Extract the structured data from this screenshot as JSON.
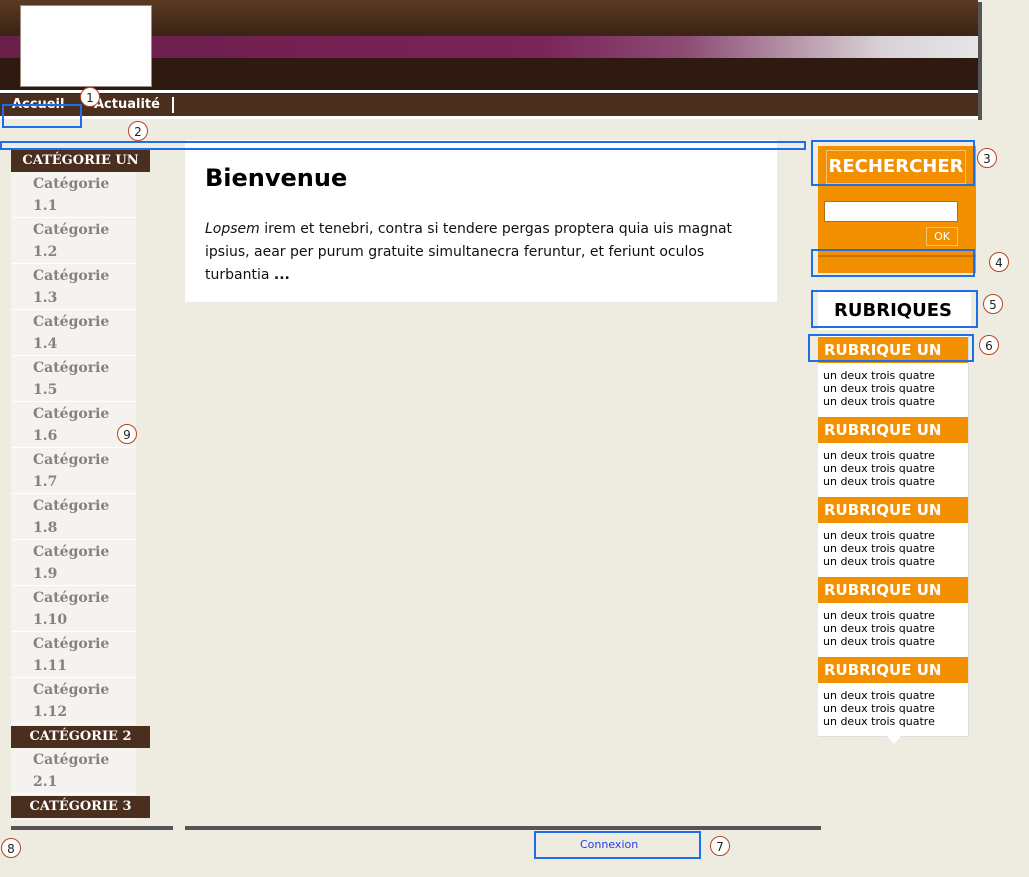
{
  "nav": {
    "items": [
      "Accueil",
      "Actualité"
    ]
  },
  "sidebar": {
    "categories": [
      {
        "label": "CATÉGORIE UN",
        "items": [
          [
            "Catégorie",
            "1.1"
          ],
          [
            "Catégorie",
            "1.2"
          ],
          [
            "Catégorie",
            "1.3"
          ],
          [
            "Catégorie",
            "1.4"
          ],
          [
            "Catégorie",
            "1.5"
          ],
          [
            "Catégorie",
            "1.6"
          ],
          [
            "Catégorie",
            "1.7"
          ],
          [
            "Catégorie",
            "1.8"
          ],
          [
            "Catégorie",
            "1.9"
          ],
          [
            "Catégorie",
            "1.10"
          ],
          [
            "Catégorie",
            "1.11"
          ],
          [
            "Catégorie",
            "1.12"
          ]
        ]
      },
      {
        "label": "CATÉGORIE 2",
        "items": [
          [
            "Catégorie",
            "2.1"
          ]
        ]
      },
      {
        "label": "CATÉGORIE 3",
        "items": []
      }
    ]
  },
  "main": {
    "title": "Bienvenue",
    "body_em": "Lopsem",
    "body_rest": " irem et tenebri, contra si tendere pergas proptera quia uis magnat ipsius, aear per purum gratuite simultanecra feruntur, et feriunt oculos turbantia",
    "body_ellipsis": "..."
  },
  "search": {
    "title": "RECHERCHER",
    "ok_label": "OK",
    "value": ""
  },
  "rubriques": {
    "title": "RUBRIQUES",
    "items": [
      {
        "head": "RUBRIQUE UN",
        "lines": [
          "un deux trois quatre",
          "un deux trois quatre",
          "un deux trois quatre"
        ]
      },
      {
        "head": "RUBRIQUE UN",
        "lines": [
          "un deux trois quatre",
          "un deux trois quatre",
          "un deux trois quatre"
        ]
      },
      {
        "head": "RUBRIQUE UN",
        "lines": [
          "un deux trois quatre",
          "un deux trois quatre",
          "un deux trois quatre"
        ]
      },
      {
        "head": "RUBRIQUE UN",
        "lines": [
          "un deux trois quatre",
          "un deux trois quatre",
          "un deux trois quatre"
        ]
      },
      {
        "head": "RUBRIQUE UN",
        "lines": [
          "un deux trois quatre",
          "un deux trois quatre",
          "un deux trois quatre"
        ]
      }
    ]
  },
  "footer": {
    "login_label": "Connexion"
  },
  "annotations": [
    "1",
    "2",
    "3",
    "4",
    "5",
    "6",
    "7",
    "8",
    "9"
  ],
  "colors": {
    "brown": "#4a2e1e",
    "orange": "#f29000",
    "purple": "#7a2458",
    "highlight": "#1e6ee8",
    "background": "#eeebe1"
  }
}
